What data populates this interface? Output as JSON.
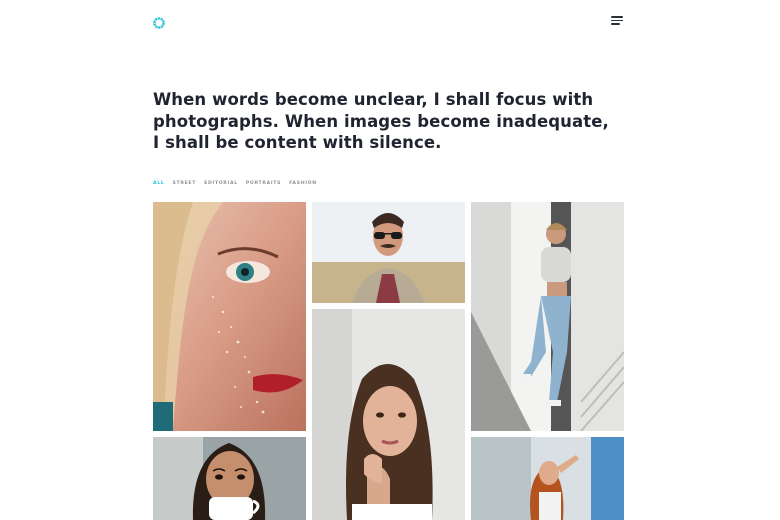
{
  "header": {
    "logo_icon": "flower-icon",
    "menu_icon": "hamburger-menu-icon",
    "accent_color": "#27c1d6"
  },
  "hero": {
    "lines": [
      "When words become unclear, I shall focus with",
      "photographs. When images become inadequate,",
      "I shall be content with silence."
    ]
  },
  "filters": {
    "items": [
      "ALL",
      "STREET",
      "EDITORIAL",
      "PORTRAITS",
      "FASHION"
    ],
    "active": "ALL"
  },
  "gallery": {
    "photos": [
      {
        "id": "t1",
        "subject": "close-up face with glitter"
      },
      {
        "id": "t2",
        "subject": "man with sunglasses and mustache"
      },
      {
        "id": "t3",
        "subject": "woman posing against wall"
      },
      {
        "id": "t4",
        "subject": "woman with long dark hair"
      },
      {
        "id": "t5",
        "subject": "woman drinking from cup"
      },
      {
        "id": "t6",
        "subject": "woman with red hair"
      }
    ]
  }
}
